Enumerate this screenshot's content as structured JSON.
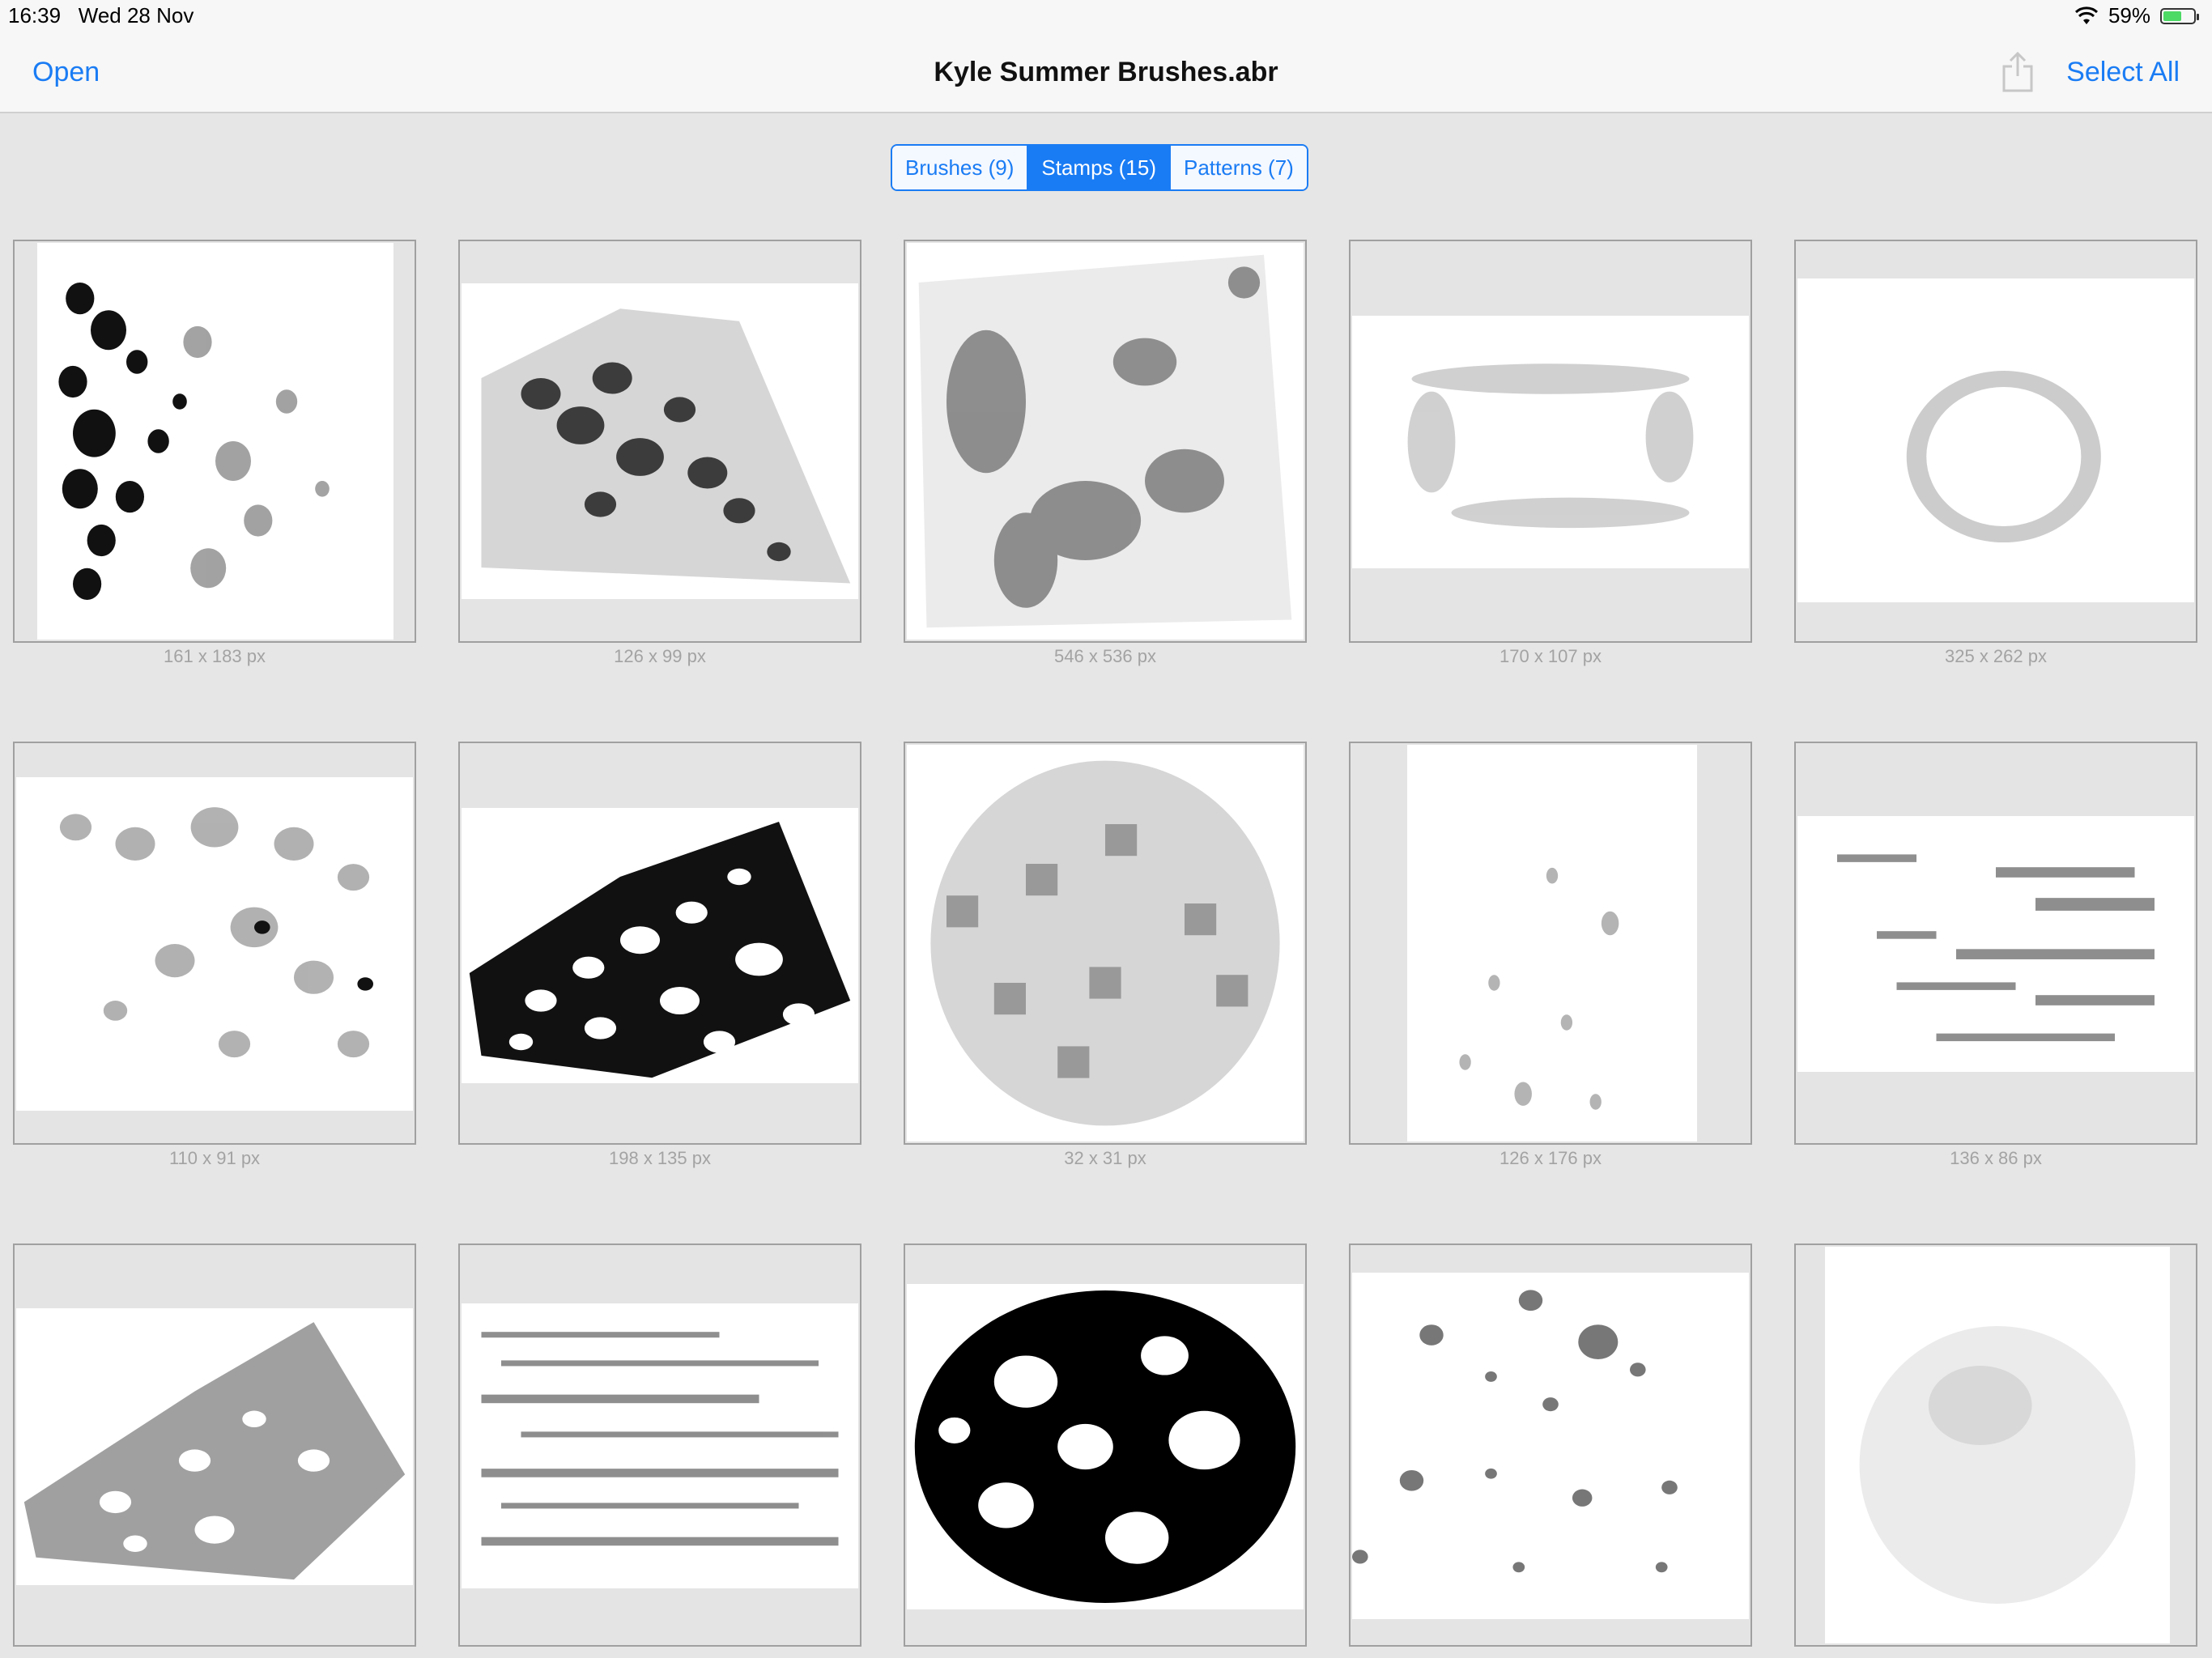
{
  "status_bar": {
    "time": "16:39",
    "date": "Wed 28 Nov",
    "battery": "59%"
  },
  "nav": {
    "open_label": "Open",
    "title": "Kyle Summer Brushes.abr",
    "select_all_label": "Select All"
  },
  "segments": [
    {
      "label": "Brushes (9)",
      "active": false
    },
    {
      "label": "Stamps (15)",
      "active": true
    },
    {
      "label": "Patterns (7)",
      "active": false
    }
  ],
  "stamps": [
    {
      "size": "161 x 183 px"
    },
    {
      "size": "126 x 99 px"
    },
    {
      "size": "546 x 536 px"
    },
    {
      "size": "170 x 107 px"
    },
    {
      "size": "325 x 262 px"
    },
    {
      "size": "110 x 91 px"
    },
    {
      "size": "198 x 135 px"
    },
    {
      "size": "32 x 31 px"
    },
    {
      "size": "126 x 176 px"
    },
    {
      "size": "136 x 86 px"
    },
    {
      "size": ""
    },
    {
      "size": ""
    },
    {
      "size": ""
    },
    {
      "size": ""
    },
    {
      "size": ""
    }
  ]
}
